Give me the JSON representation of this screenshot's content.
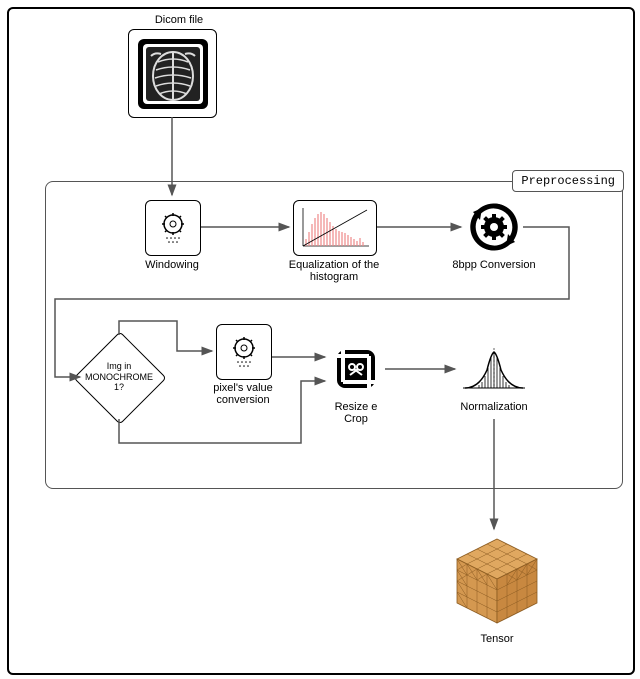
{
  "diagram": {
    "input_label": "Dicom  file",
    "preprocessing_label": "Preprocessing",
    "windowing": "Windowing",
    "equalization": "Equalization of the\nhistogram",
    "conversion_8bpp": "8bpp Conversion",
    "decision": "Img in\nMONOCHROME\n1?",
    "pixel_conversion": "pixel's value\nconversion",
    "resize_crop": "Resize e\nCrop",
    "normalization": "Normalization",
    "output_label": "Tensor"
  }
}
